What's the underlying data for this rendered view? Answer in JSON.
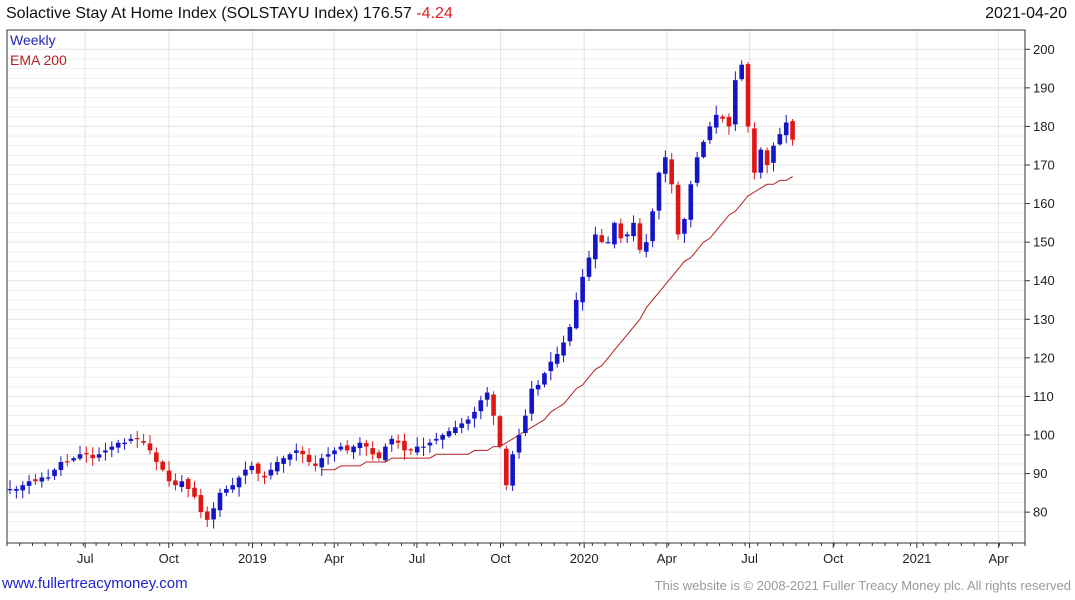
{
  "header": {
    "title": "Solactive Stay At Home Index (SOLSTAYU Index) 176.57",
    "change": "-4.24",
    "date": "2021-04-20"
  },
  "footer": {
    "site": "www.fullertreacymoney.com",
    "copyright": "This website is © 2008-2021 Fuller Treacy Money plc. All rights reserved"
  },
  "legend": {
    "frequency": "Weekly",
    "ema_label": "EMA 200",
    "frequency_color": "#2222bb",
    "ema_color": "#b22222"
  },
  "colors": {
    "up": "#1515c8",
    "down": "#e01515",
    "ema": "#b22222",
    "grid": "#e4e4e4",
    "frame": "#333333"
  },
  "chart_data": {
    "type": "candlestick",
    "title": "Solactive Stay At Home Index (SOLSTAYU Index)",
    "frequency": "weekly",
    "ylim": [
      72,
      205
    ],
    "yticks": [
      80,
      90,
      100,
      110,
      120,
      130,
      140,
      150,
      160,
      170,
      180,
      190,
      200
    ],
    "x_start": "2018-04-06",
    "x_end": "2021-04-30",
    "xticks": [
      {
        "label": "Jul",
        "date": "2018-07-01"
      },
      {
        "label": "Oct",
        "date": "2018-10-01"
      },
      {
        "label": "2019",
        "date": "2019-01-01"
      },
      {
        "label": "Apr",
        "date": "2019-04-01"
      },
      {
        "label": "Jul",
        "date": "2019-07-01"
      },
      {
        "label": "Oct",
        "date": "2019-10-01"
      },
      {
        "label": "2020",
        "date": "2020-01-01"
      },
      {
        "label": "Apr",
        "date": "2020-04-01"
      },
      {
        "label": "Jul",
        "date": "2020-07-01"
      },
      {
        "label": "Oct",
        "date": "2020-10-01"
      },
      {
        "label": "2021",
        "date": "2021-01-01"
      },
      {
        "label": "Apr",
        "date": "2021-04-01"
      }
    ],
    "grid": true,
    "legend_position": "top-left",
    "ohlc_closes": [
      86,
      86,
      87,
      88,
      88,
      89,
      89,
      91,
      93,
      93,
      94,
      95,
      95,
      94,
      95,
      96,
      97,
      98,
      98,
      99,
      99,
      98,
      96,
      93,
      91,
      88,
      87,
      88,
      86,
      84,
      80,
      78,
      81,
      85,
      86,
      87,
      89,
      91,
      92,
      90,
      89,
      91,
      93,
      94,
      95,
      96,
      95,
      93,
      92,
      94,
      95,
      96,
      97,
      96,
      97,
      98,
      97,
      95,
      94,
      97,
      99,
      98,
      96,
      96,
      97,
      97,
      98,
      99,
      100,
      101,
      102,
      103,
      104,
      106,
      109,
      111,
      105,
      97,
      87,
      95,
      100,
      105,
      112,
      113,
      116,
      119,
      121,
      124,
      128,
      135,
      141,
      146,
      152,
      150,
      150,
      155,
      151,
      152,
      155,
      148,
      150,
      158,
      168,
      172,
      165,
      152,
      156,
      165,
      172,
      176,
      180,
      183,
      182,
      180,
      192,
      196,
      180,
      168,
      174,
      170,
      175,
      178,
      181,
      176.57
    ],
    "ema200": [
      91,
      91,
      91,
      92,
      92,
      92,
      92,
      93,
      93,
      93,
      93,
      94,
      94,
      94,
      94,
      94,
      94,
      94,
      95,
      95,
      95,
      95,
      95,
      95,
      96,
      96,
      96,
      97,
      97,
      98,
      99,
      100,
      101,
      102,
      103,
      104,
      106,
      107,
      108,
      110,
      112,
      113,
      115,
      117,
      118,
      120,
      122,
      124,
      126,
      128,
      130,
      133,
      135,
      137,
      139,
      141,
      143,
      145,
      146,
      148,
      150,
      151,
      153,
      155,
      157,
      158,
      160,
      162,
      163,
      164,
      165,
      165,
      166,
      166,
      167
    ]
  }
}
